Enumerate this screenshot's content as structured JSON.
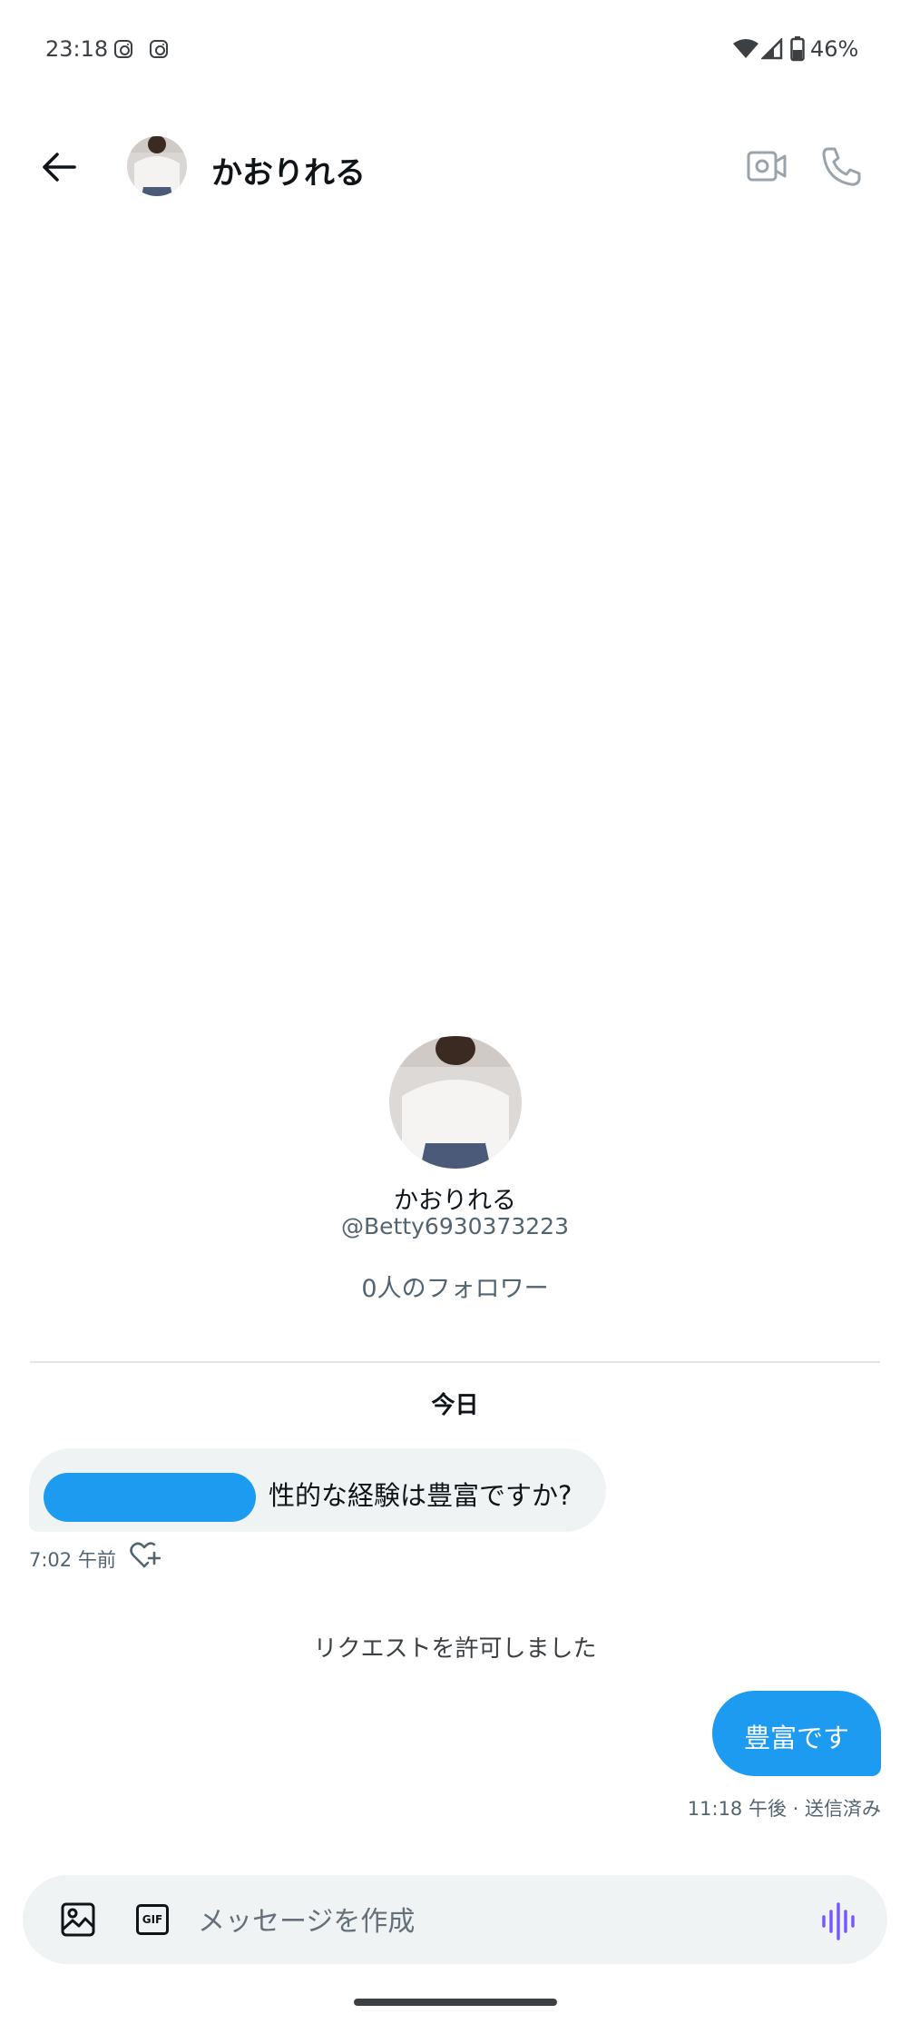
{
  "status_bar": {
    "time": "23:18",
    "battery": "46%"
  },
  "header": {
    "title": "かおりれる"
  },
  "profile": {
    "name": "かおりれる",
    "handle": "@Betty6930373223",
    "followers": "0人のフォロワー"
  },
  "conversation": {
    "date_divider": "今日",
    "incoming": {
      "text": "性的な経験は豊富ですか?",
      "time": "7:02 午前"
    },
    "event": "リクエストを許可しました",
    "outgoing": {
      "text": "豊富です",
      "meta": "11:18 午後 · 送信済み"
    }
  },
  "composer": {
    "placeholder": "メッセージを作成",
    "gif_label": "GIF"
  },
  "colors": {
    "accent": "#1d9bf0",
    "bubble_gray": "#eff3f4",
    "voice": "#7856ff"
  },
  "icons": [
    "instagram-icon",
    "wifi-icon",
    "signal-icon",
    "battery-icon",
    "back-arrow-icon",
    "video-call-icon",
    "phone-icon",
    "heart-add-icon",
    "image-icon",
    "gif-icon",
    "voice-wave-icon"
  ]
}
